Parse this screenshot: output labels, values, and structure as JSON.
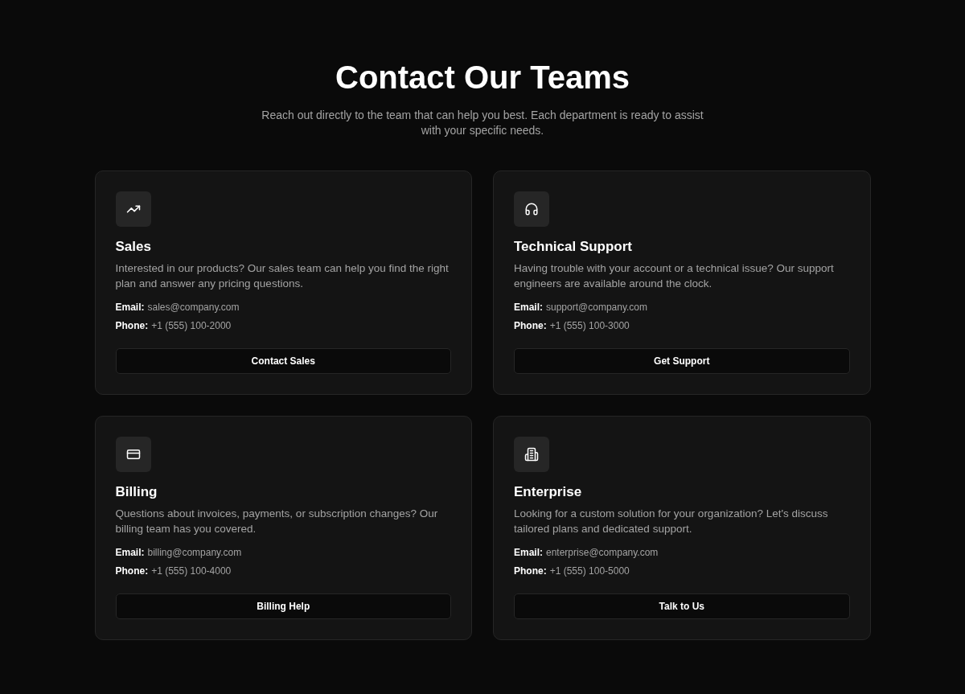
{
  "header": {
    "title": "Contact Our Teams",
    "subtitle": "Reach out directly to the team that can help you best. Each department is ready to assist with your specific needs."
  },
  "teams": [
    {
      "name": "Sales",
      "description": "Interested in our products? Our sales team can help you find the right plan and answer any pricing questions.",
      "email_label": "Email:",
      "email": "sales@company.com",
      "phone_label": "Phone:",
      "phone": "+1 (555) 100-2000",
      "button": "Contact Sales"
    },
    {
      "name": "Technical Support",
      "description": "Having trouble with your account or a technical issue? Our support engineers are available around the clock.",
      "email_label": "Email:",
      "email": "support@company.com",
      "phone_label": "Phone:",
      "phone": "+1 (555) 100-3000",
      "button": "Get Support"
    },
    {
      "name": "Billing",
      "description": "Questions about invoices, payments, or subscription changes? Our billing team has you covered.",
      "email_label": "Email:",
      "email": "billing@company.com",
      "phone_label": "Phone:",
      "phone": "+1 (555) 100-4000",
      "button": "Billing Help"
    },
    {
      "name": "Enterprise",
      "description": "Looking for a custom solution for your organization? Let's discuss tailored plans and dedicated support.",
      "email_label": "Email:",
      "email": "enterprise@company.com",
      "phone_label": "Phone:",
      "phone": "+1 (555) 100-5000",
      "button": "Talk to Us"
    }
  ]
}
